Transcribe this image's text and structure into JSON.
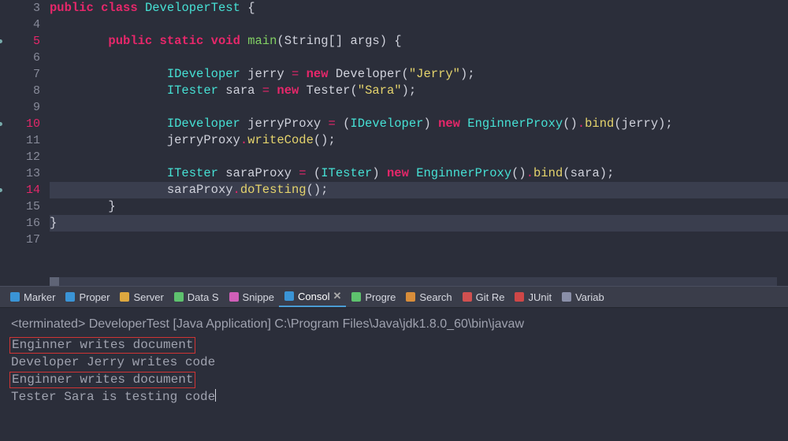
{
  "editor": {
    "lines": [
      {
        "n": "3",
        "dot": false,
        "tokens": [
          [
            "kw",
            "public"
          ],
          [
            "sp",
            " "
          ],
          [
            "kw",
            "class"
          ],
          [
            "sp",
            " "
          ],
          [
            "type",
            "DeveloperTest"
          ],
          [
            "sp",
            " "
          ],
          [
            "punc",
            "{"
          ]
        ]
      },
      {
        "n": "4",
        "dot": false,
        "tokens": []
      },
      {
        "n": "5",
        "dot": true,
        "indent": 1,
        "tokens": [
          [
            "kw",
            "public"
          ],
          [
            "sp",
            " "
          ],
          [
            "kw",
            "static"
          ],
          [
            "sp",
            " "
          ],
          [
            "kw",
            "void"
          ],
          [
            "sp",
            " "
          ],
          [
            "fn",
            "main"
          ],
          [
            "punc",
            "("
          ],
          [
            "pl",
            "String"
          ],
          [
            "punc",
            "[]"
          ],
          [
            "sp",
            " "
          ],
          [
            "pl",
            "args"
          ],
          [
            "punc",
            ") {"
          ]
        ]
      },
      {
        "n": "6",
        "dot": false,
        "tokens": []
      },
      {
        "n": "7",
        "dot": false,
        "indent": 2,
        "tokens": [
          [
            "type",
            "IDeveloper"
          ],
          [
            "sp",
            " "
          ],
          [
            "pl",
            "jerry"
          ],
          [
            "sp",
            " "
          ],
          [
            "op",
            "="
          ],
          [
            "sp",
            " "
          ],
          [
            "kw",
            "new"
          ],
          [
            "sp",
            " "
          ],
          [
            "pl",
            "Developer"
          ],
          [
            "punc",
            "("
          ],
          [
            "str",
            "\"Jerry\""
          ],
          [
            "punc",
            ");"
          ]
        ]
      },
      {
        "n": "8",
        "dot": false,
        "indent": 2,
        "tokens": [
          [
            "type",
            "ITester"
          ],
          [
            "sp",
            " "
          ],
          [
            "pl",
            "sara"
          ],
          [
            "sp",
            " "
          ],
          [
            "op",
            "="
          ],
          [
            "sp",
            " "
          ],
          [
            "kw",
            "new"
          ],
          [
            "sp",
            " "
          ],
          [
            "pl",
            "Tester"
          ],
          [
            "punc",
            "("
          ],
          [
            "str",
            "\"Sara\""
          ],
          [
            "punc",
            ");"
          ]
        ]
      },
      {
        "n": "9",
        "dot": false,
        "tokens": []
      },
      {
        "n": "10",
        "dot": true,
        "indent": 2,
        "tokens": [
          [
            "type",
            "IDeveloper"
          ],
          [
            "sp",
            " "
          ],
          [
            "pl",
            "jerryProxy"
          ],
          [
            "sp",
            " "
          ],
          [
            "op",
            "="
          ],
          [
            "sp",
            " "
          ],
          [
            "punc",
            "("
          ],
          [
            "type",
            "IDeveloper"
          ],
          [
            "punc",
            ")"
          ],
          [
            "sp",
            " "
          ],
          [
            "kw",
            "new"
          ],
          [
            "sp",
            " "
          ],
          [
            "type",
            "EnginnerProxy"
          ],
          [
            "punc",
            "()"
          ],
          [
            "dot",
            "."
          ],
          [
            "mth",
            "bind"
          ],
          [
            "punc",
            "("
          ],
          [
            "pl",
            "jerry"
          ],
          [
            "punc",
            ");"
          ]
        ]
      },
      {
        "n": "11",
        "dot": false,
        "indent": 2,
        "tokens": [
          [
            "pl",
            "jerryProxy"
          ],
          [
            "dot",
            "."
          ],
          [
            "mth",
            "writeCode"
          ],
          [
            "punc",
            "();"
          ]
        ]
      },
      {
        "n": "12",
        "dot": false,
        "tokens": []
      },
      {
        "n": "13",
        "dot": false,
        "indent": 2,
        "tokens": [
          [
            "type",
            "ITester"
          ],
          [
            "sp",
            " "
          ],
          [
            "pl",
            "saraProxy"
          ],
          [
            "sp",
            " "
          ],
          [
            "op",
            "="
          ],
          [
            "sp",
            " "
          ],
          [
            "punc",
            "("
          ],
          [
            "type",
            "ITester"
          ],
          [
            "punc",
            ")"
          ],
          [
            "sp",
            " "
          ],
          [
            "kw",
            "new"
          ],
          [
            "sp",
            " "
          ],
          [
            "type",
            "EnginnerProxy"
          ],
          [
            "punc",
            "()"
          ],
          [
            "dot",
            "."
          ],
          [
            "mth",
            "bind"
          ],
          [
            "punc",
            "("
          ],
          [
            "pl",
            "sara"
          ],
          [
            "punc",
            ");"
          ]
        ]
      },
      {
        "n": "14",
        "dot": true,
        "indent": 2,
        "hl": true,
        "tokens": [
          [
            "pl",
            "saraProxy"
          ],
          [
            "dot",
            "."
          ],
          [
            "mth",
            "doTesting"
          ],
          [
            "punc",
            "();"
          ]
        ]
      },
      {
        "n": "15",
        "dot": false,
        "indent": 1,
        "tokens": [
          [
            "punc",
            "}"
          ]
        ]
      },
      {
        "n": "16",
        "dot": false,
        "hl": true,
        "tokens": [
          [
            "punc",
            "}"
          ]
        ]
      },
      {
        "n": "17",
        "dot": false,
        "tokens": []
      }
    ]
  },
  "tabs": [
    {
      "label": "Marker",
      "icon": "#3a94d6",
      "active": false
    },
    {
      "label": "Proper",
      "icon": "#3a94d6",
      "active": false
    },
    {
      "label": "Server",
      "icon": "#dda73f",
      "active": false
    },
    {
      "label": "Data S",
      "icon": "#5ec26e",
      "active": false
    },
    {
      "label": "Snippe",
      "icon": "#d05fb8",
      "active": false
    },
    {
      "label": "Consol",
      "icon": "#3a94d6",
      "active": true,
      "close": true
    },
    {
      "label": "Progre",
      "icon": "#5ec26e",
      "active": false
    },
    {
      "label": "Search",
      "icon": "#d88d3a",
      "active": false
    },
    {
      "label": "Git Re",
      "icon": "#d05050",
      "active": false
    },
    {
      "label": "JUnit",
      "icon": "#cf4747",
      "active": false,
      "prefix": "JU"
    },
    {
      "label": "Variab",
      "icon": "#8a8fa8",
      "active": false
    }
  ],
  "console": {
    "terminated": "<terminated> DeveloperTest [Java Application] C:\\Program Files\\Java\\jdk1.8.0_60\\bin\\javaw",
    "lines": [
      {
        "text": "Enginner writes document",
        "boxed": true
      },
      {
        "text": "Developer Jerry writes code",
        "boxed": false
      },
      {
        "text": "Enginner writes document",
        "boxed": true
      },
      {
        "text": "Tester Sara is testing code",
        "boxed": false,
        "caret": true
      }
    ]
  }
}
